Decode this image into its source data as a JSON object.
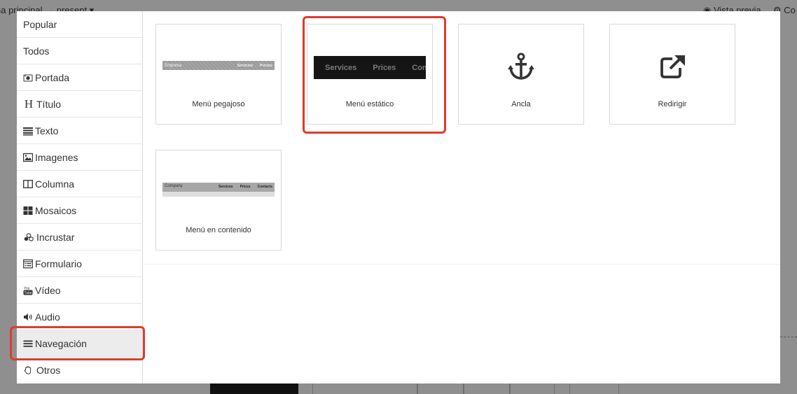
{
  "background": {
    "page_title": "na principal → present ▾",
    "preview_label": "Vista previa",
    "config_label": "Co"
  },
  "sidebar": {
    "items": [
      {
        "label": "Popular",
        "icon": ""
      },
      {
        "label": "Todos",
        "icon": ""
      },
      {
        "label": "Portada",
        "icon": "camera-icon"
      },
      {
        "label": "Título",
        "icon": "heading-icon"
      },
      {
        "label": "Texto",
        "icon": "align-justify-icon"
      },
      {
        "label": "Imagenes",
        "icon": "image-icon"
      },
      {
        "label": "Columna",
        "icon": "columns-icon"
      },
      {
        "label": "Mosaicos",
        "icon": "grid-icon"
      },
      {
        "label": "Incrustar",
        "icon": "cubes-icon"
      },
      {
        "label": "Formulario",
        "icon": "form-icon"
      },
      {
        "label": "Vídeo",
        "icon": "youtube-icon"
      },
      {
        "label": "Audio",
        "icon": "volume-icon"
      },
      {
        "label": "Navegación",
        "icon": "bars-icon",
        "active": true
      },
      {
        "label": "Otros",
        "icon": "hand-icon"
      }
    ]
  },
  "tiles": [
    {
      "label": "Menú pegajoso",
      "preview": {
        "brand": "Empresa",
        "links": [
          "Servicios",
          "Precios"
        ]
      }
    },
    {
      "label": "Menú estático",
      "preview": {
        "links": [
          "Services",
          "Prices",
          "Conta"
        ]
      }
    },
    {
      "label": "Ancla",
      "icon": "anchor-icon"
    },
    {
      "label": "Redirigir",
      "icon": "external-link-icon"
    },
    {
      "label": "Menú en contenido",
      "preview": {
        "brand": "Company",
        "links": [
          "Services",
          "Prices",
          "Contacts"
        ]
      }
    }
  ],
  "colors": {
    "highlight": "#e03b2c",
    "overlay": "#8f8f8f",
    "active_item_bg": "#ececec"
  }
}
